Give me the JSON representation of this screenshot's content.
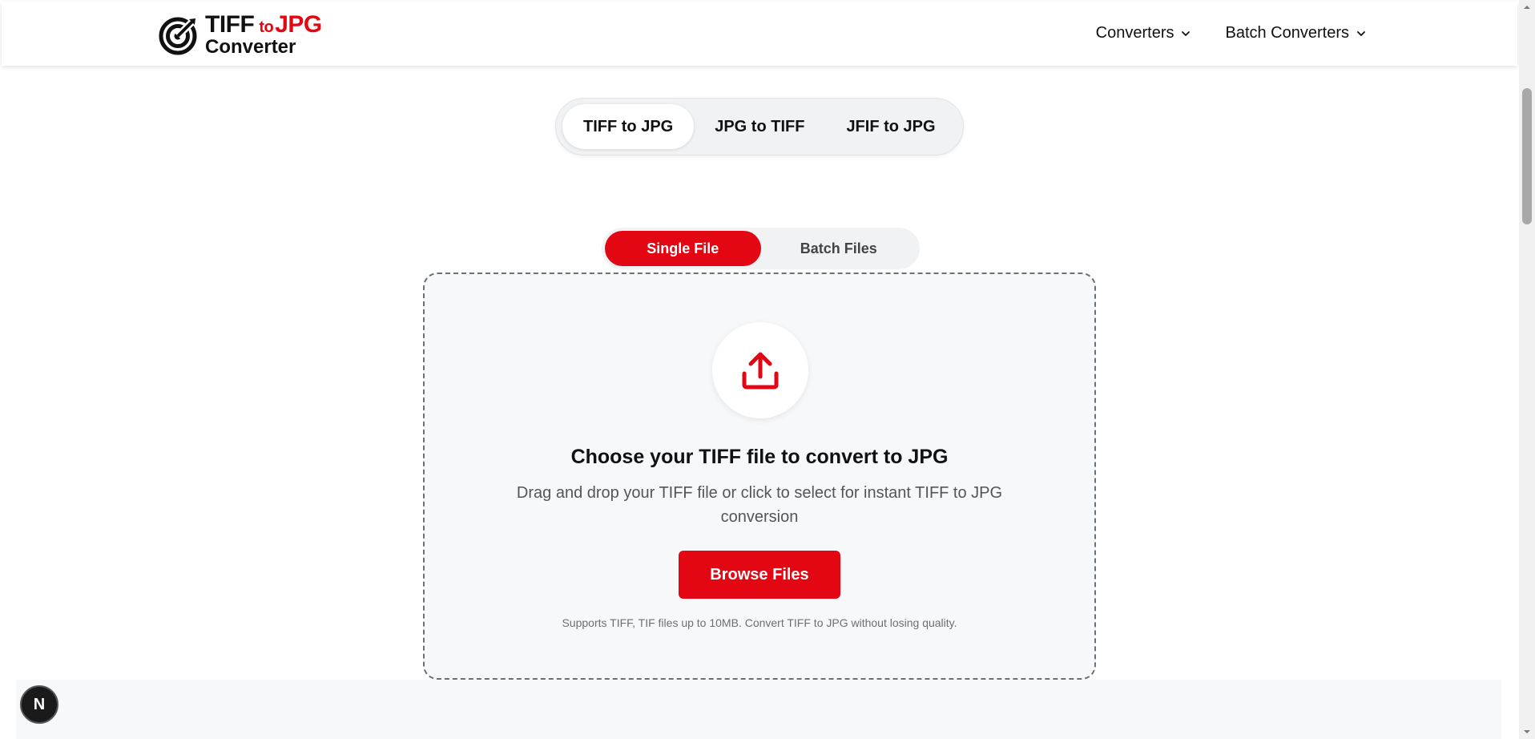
{
  "header": {
    "logo": {
      "line1_left": "TIFF",
      "line1_mid": "to",
      "line1_right": "JPG",
      "line2": "Converter"
    },
    "nav": [
      {
        "label": "Converters"
      },
      {
        "label": "Batch Converters"
      }
    ]
  },
  "converter_tabs": [
    {
      "label": "TIFF to JPG",
      "active": true
    },
    {
      "label": "JPG to TIFF",
      "active": false
    },
    {
      "label": "JFIF to JPG",
      "active": false
    }
  ],
  "mode_toggle": {
    "single": "Single File",
    "batch": "Batch Files",
    "selected": "Single File"
  },
  "dropzone": {
    "icon": "upload-icon",
    "title": "Choose your TIFF file to convert to JPG",
    "description": "Drag and drop your TIFF file or click to select for instant TIFF to JPG conversion",
    "button": "Browse Files",
    "support": "Supports TIFF, TIF files up to 10MB. Convert TIFF to JPG without losing quality."
  },
  "badge": {
    "label": "N"
  },
  "colors": {
    "accent": "#e30613",
    "text": "#111111",
    "muted": "#6b6f76",
    "surface": "#f7f8fa"
  }
}
